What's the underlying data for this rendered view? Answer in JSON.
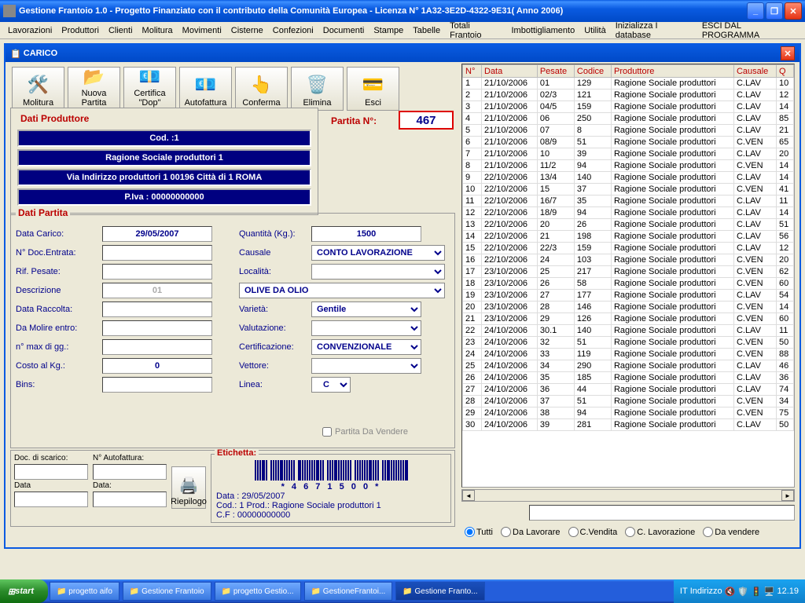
{
  "window": {
    "title": "Gestione Frantoio 1.0 - Progetto Finanziato con il contributo della Comunità Europea - Licenza N° 1A32-3E2D-4322-9E31( Anno 2006)"
  },
  "menu": [
    "Lavorazioni",
    "Produttori",
    "Clienti",
    "Molitura",
    "Movimenti",
    "Cisterne",
    "Confezioni",
    "Documenti",
    "Stampe",
    "Tabelle",
    "Totali Frantoio",
    "Imbottigliamento",
    "Utilità",
    "Inizializza I database",
    "ESCI DAL PROGRAMMA"
  ],
  "child_title": "CARICO",
  "toolbar": [
    {
      "label": "Molitura",
      "icon": "🛠️"
    },
    {
      "label": "Nuova Partita",
      "icon": "📂"
    },
    {
      "label": "Certifica \"Dop\"",
      "icon": "💶"
    },
    {
      "label": "Autofattura",
      "icon": "💶"
    },
    {
      "label": "Conferma",
      "icon": "👆"
    },
    {
      "label": "Elimina",
      "icon": "🗑️"
    },
    {
      "label": "Esci",
      "icon": "💳"
    }
  ],
  "producer": {
    "title": "Dati  Produttore",
    "rows": [
      "Cod. :1",
      "Ragione Sociale produttori 1",
      "Via Indirizzo produttori 1 00196 Città di 1 ROMA",
      "P.Iva : 00000000000"
    ]
  },
  "partita_no_label": "Partita N°:",
  "partita_no": "467",
  "dati_partita": {
    "legend": "Dati Partita",
    "data_carico_lbl": "Data Carico:",
    "data_carico": "29/05/2007",
    "ndoc_lbl": "N° Doc.Entrata:",
    "ndoc": "",
    "rif_lbl": "Rif. Pesate:",
    "rif": "",
    "descr_lbl": "Descrizione",
    "descr": "01",
    "raccolta_lbl": "Data Raccolta:",
    "raccolta": "",
    "molire_lbl": "Da Molire entro:",
    "molire": "",
    "nmax_lbl": "n° max di gg.:",
    "nmax": "",
    "costo_lbl": "Costo al Kg.:",
    "costo": "0",
    "bins_lbl": "Bins:",
    "bins": "",
    "qta_lbl": "Quantità (Kg.):",
    "qta": "1500",
    "causale_lbl": "Causale",
    "causale": "CONTO LAVORAZIONE",
    "localita_lbl": "Località:",
    "localita": "",
    "tipo": "OLIVE DA OLIO",
    "varieta_lbl": "Varietà:",
    "varieta": "Gentile",
    "valut_lbl": "Valutazione:",
    "valut": "",
    "cert_lbl": "Certificazione:",
    "cert": "CONVENZIONALE",
    "vettore_lbl": "Vettore:",
    "vettore": "",
    "linea_lbl": "Linea:",
    "linea": "C",
    "vendere": "Partita Da Vendere"
  },
  "bottom": {
    "doc_scarico": "Doc. di scarico:",
    "n_auto": "N° Autofattura:",
    "data1": "Data",
    "data2": "Data:",
    "riepilogo": "Riepilogo",
    "etichetta": "Etichetta:",
    "barnum": "* 4 6 7   1 5 0 0 *",
    "l1": "Data : 29/05/2007",
    "l2": "Cod.: 1   Prod.: Ragione Sociale produttori 1",
    "l3": "C.F : 00000000000"
  },
  "grid": {
    "headers": [
      "N°",
      "Data",
      "Pesate",
      "Codice",
      "Produttore",
      "Causale",
      "Q"
    ],
    "rows": [
      [
        "1",
        "21/10/2006",
        "01",
        "129",
        "Ragione Sociale produttori",
        "C.LAV",
        "10"
      ],
      [
        "2",
        "21/10/2006",
        "02/3",
        "121",
        "Ragione Sociale produttori",
        "C.LAV",
        "12"
      ],
      [
        "3",
        "21/10/2006",
        "04/5",
        "159",
        "Ragione Sociale produttori",
        "C.LAV",
        "14"
      ],
      [
        "4",
        "21/10/2006",
        "06",
        "250",
        "Ragione Sociale produttori",
        "C.LAV",
        "85"
      ],
      [
        "5",
        "21/10/2006",
        "07",
        "8",
        "Ragione Sociale produttori",
        "C.LAV",
        "21"
      ],
      [
        "6",
        "21/10/2006",
        "08/9",
        "51",
        "Ragione Sociale produttori",
        "C.VEN",
        "65"
      ],
      [
        "7",
        "21/10/2006",
        "10",
        "39",
        "Ragione Sociale produttori",
        "C.LAV",
        "20"
      ],
      [
        "8",
        "21/10/2006",
        "11/2",
        "94",
        "Ragione Sociale produttori",
        "C.VEN",
        "14"
      ],
      [
        "9",
        "22/10/2006",
        "13/4",
        "140",
        "Ragione Sociale produttori",
        "C.LAV",
        "14"
      ],
      [
        "10",
        "22/10/2006",
        "15",
        "37",
        "Ragione Sociale produttori",
        "C.VEN",
        "41"
      ],
      [
        "11",
        "22/10/2006",
        "16/7",
        "35",
        "Ragione Sociale produttori",
        "C.LAV",
        "11"
      ],
      [
        "12",
        "22/10/2006",
        "18/9",
        "94",
        "Ragione Sociale produttori",
        "C.LAV",
        "14"
      ],
      [
        "13",
        "22/10/2006",
        "20",
        "26",
        "Ragione Sociale produttori",
        "C.LAV",
        "51"
      ],
      [
        "14",
        "22/10/2006",
        "21",
        "198",
        "Ragione Sociale produttori",
        "C.LAV",
        "56"
      ],
      [
        "15",
        "22/10/2006",
        "22/3",
        "159",
        "Ragione Sociale produttori",
        "C.LAV",
        "12"
      ],
      [
        "16",
        "22/10/2006",
        "24",
        "103",
        "Ragione Sociale produttori",
        "C.VEN",
        "20"
      ],
      [
        "17",
        "23/10/2006",
        "25",
        "217",
        "Ragione Sociale produttori",
        "C.VEN",
        "62"
      ],
      [
        "18",
        "23/10/2006",
        "26",
        "58",
        "Ragione Sociale produttori",
        "C.VEN",
        "60"
      ],
      [
        "19",
        "23/10/2006",
        "27",
        "177",
        "Ragione Sociale produttori",
        "C.LAV",
        "54"
      ],
      [
        "20",
        "23/10/2006",
        "28",
        "146",
        "Ragione Sociale produttori",
        "C.VEN",
        "14"
      ],
      [
        "21",
        "23/10/2006",
        "29",
        "126",
        "Ragione Sociale produttori",
        "C.VEN",
        "60"
      ],
      [
        "22",
        "24/10/2006",
        "30.1",
        "140",
        "Ragione Sociale produttori",
        "C.LAV",
        "11"
      ],
      [
        "23",
        "24/10/2006",
        "32",
        "51",
        "Ragione Sociale produttori",
        "C.VEN",
        "50"
      ],
      [
        "24",
        "24/10/2006",
        "33",
        "119",
        "Ragione Sociale produttori",
        "C.VEN",
        "88"
      ],
      [
        "25",
        "24/10/2006",
        "34",
        "290",
        "Ragione Sociale produttori",
        "C.LAV",
        "46"
      ],
      [
        "26",
        "24/10/2006",
        "35",
        "185",
        "Ragione Sociale produttori",
        "C.LAV",
        "36"
      ],
      [
        "27",
        "24/10/2006",
        "36",
        "44",
        "Ragione Sociale produttori",
        "C.LAV",
        "74"
      ],
      [
        "28",
        "24/10/2006",
        "37",
        "51",
        "Ragione Sociale produttori",
        "C.VEN",
        "34"
      ],
      [
        "29",
        "24/10/2006",
        "38",
        "94",
        "Ragione Sociale produttori",
        "C.VEN",
        "75"
      ],
      [
        "30",
        "24/10/2006",
        "39",
        "281",
        "Ragione Sociale produttori",
        "C.LAV",
        "50"
      ]
    ]
  },
  "radios": [
    "Tutti",
    "Da Lavorare",
    "C.Vendita",
    "C. Lavorazione",
    "Da vendere"
  ],
  "taskbar": {
    "start": "start",
    "buttons": [
      "progetto aifo",
      "Gestione Frantoio",
      "progetto Gestio...",
      "GestioneFrantoi...",
      "Gestione Franto..."
    ],
    "active": 4,
    "lang": "IT",
    "indir": "Indirizzo",
    "time": "12.19"
  }
}
